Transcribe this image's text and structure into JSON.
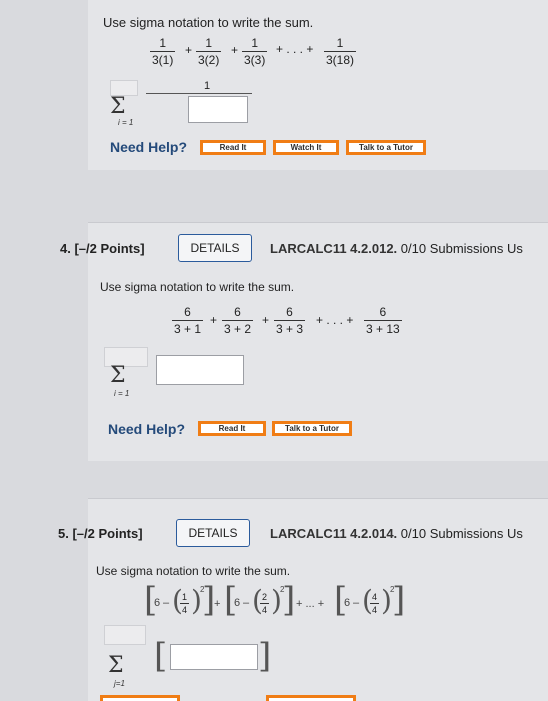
{
  "q3": {
    "prompt": "Use sigma notation to write the sum.",
    "terms": [
      {
        "num": "1",
        "den": "3(1)"
      },
      {
        "num": "1",
        "den": "3(2)"
      },
      {
        "num": "1",
        "den": "3(3)"
      },
      {
        "num": "1",
        "den": "3(18)"
      }
    ],
    "plus": "+",
    "dots": "+ . . . +",
    "answer_numerator": "1",
    "sigma": "Σ",
    "index": "i = 1",
    "need_help": "Need Help?",
    "buttons": [
      "Read It",
      "Watch It",
      "Talk to a Tutor"
    ]
  },
  "q4": {
    "number": "4.",
    "points": "[–/2 Points]",
    "details": "DETAILS",
    "code": "LARCALC11 4.2.012.",
    "submissions": "0/10 Submissions Us",
    "prompt": "Use sigma notation to write the sum.",
    "terms": [
      {
        "num": "6",
        "den": "3 + 1"
      },
      {
        "num": "6",
        "den": "3 + 2"
      },
      {
        "num": "6",
        "den": "3 + 3"
      },
      {
        "num": "6",
        "den": "3 + 13"
      }
    ],
    "plus": "+",
    "dots": "+ . . . +",
    "sigma": "Σ",
    "index": "i = 1",
    "need_help": "Need Help?",
    "buttons": [
      "Read It",
      "Talk to a Tutor"
    ]
  },
  "q5": {
    "number": "5.",
    "points": "[–/2 Points]",
    "details": "DETAILS",
    "code": "LARCALC11 4.2.014.",
    "submissions": "0/10 Submissions Us",
    "prompt": "Use sigma notation to write the sum.",
    "six": "6",
    "minus": "–",
    "frac_nums": [
      "1",
      "2",
      "4"
    ],
    "frac_den": "4",
    "exp": "2",
    "plus": "+",
    "dots": "+ ... +",
    "sigma": "Σ",
    "index": "j=1"
  }
}
